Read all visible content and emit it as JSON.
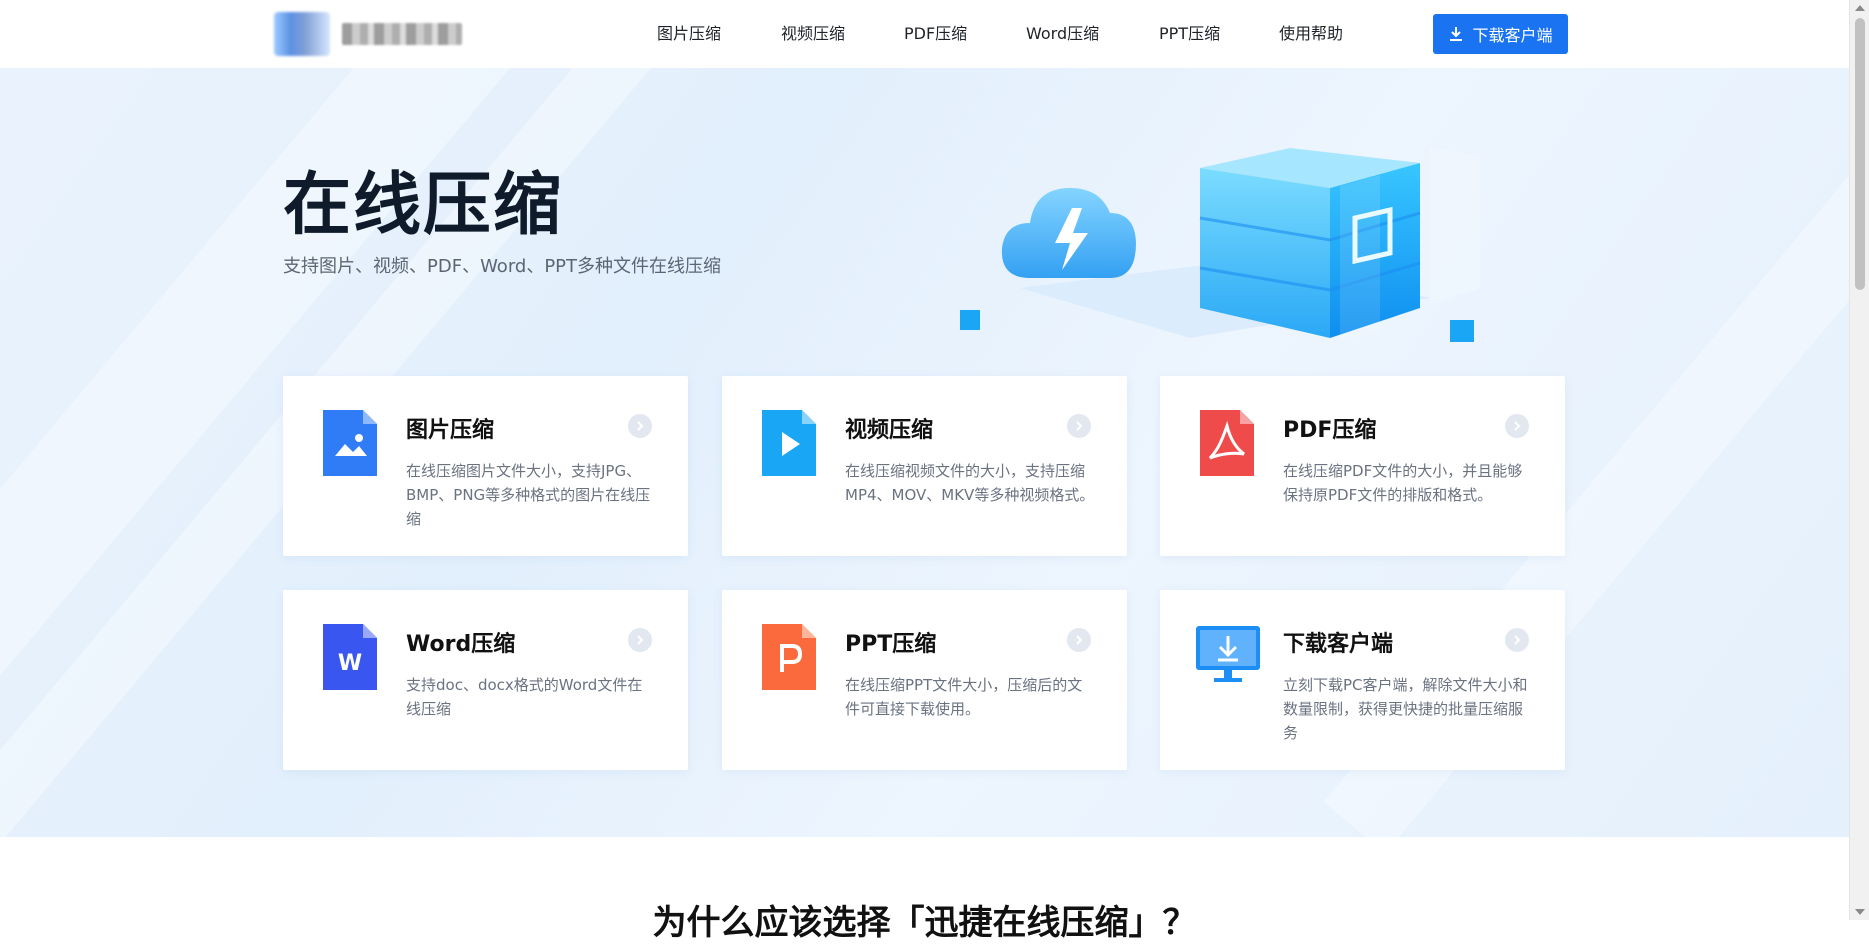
{
  "header": {
    "nav": [
      {
        "label": "图片压缩"
      },
      {
        "label": "视频压缩"
      },
      {
        "label": "PDF压缩"
      },
      {
        "label": "Word压缩"
      },
      {
        "label": "PPT压缩"
      },
      {
        "label": "使用帮助"
      }
    ],
    "download_label": "下载客户端"
  },
  "hero": {
    "title": "在线压缩",
    "subtitle": "支持图片、视频、PDF、Word、PPT多种文件在线压缩"
  },
  "cards": [
    {
      "title": "图片压缩",
      "desc": "在线压缩图片文件大小，支持JPG、BMP、PNG等多种格式的图片在线压缩",
      "icon": "image-file-icon",
      "color": "#2f7cf6"
    },
    {
      "title": "视频压缩",
      "desc": "在线压缩视频文件的大小，支持压缩MP4、MOV、MKV等多种视频格式。",
      "icon": "video-file-icon",
      "color": "#19a6f5"
    },
    {
      "title": "PDF压缩",
      "desc": "在线压缩PDF文件的大小，并且能够保持原PDF文件的排版和格式。",
      "icon": "pdf-file-icon",
      "color": "#f04b4b"
    },
    {
      "title": "Word压缩",
      "desc": "支持doc、docx格式的Word文件在线压缩",
      "icon": "word-file-icon",
      "color": "#3a56f0"
    },
    {
      "title": "PPT压缩",
      "desc": "在线压缩PPT文件大小，压缩后的文件可直接下载使用。",
      "icon": "ppt-file-icon",
      "color": "#fb6a3c"
    },
    {
      "title": "下载客户端",
      "desc": "立刻下载PC客户端，解除文件大小和数量限制，获得更快捷的批量压缩服务",
      "icon": "monitor-download-icon",
      "color": "#1d8ef5"
    }
  ],
  "section": {
    "title": "为什么应该选择「迅捷在线压缩」？"
  }
}
